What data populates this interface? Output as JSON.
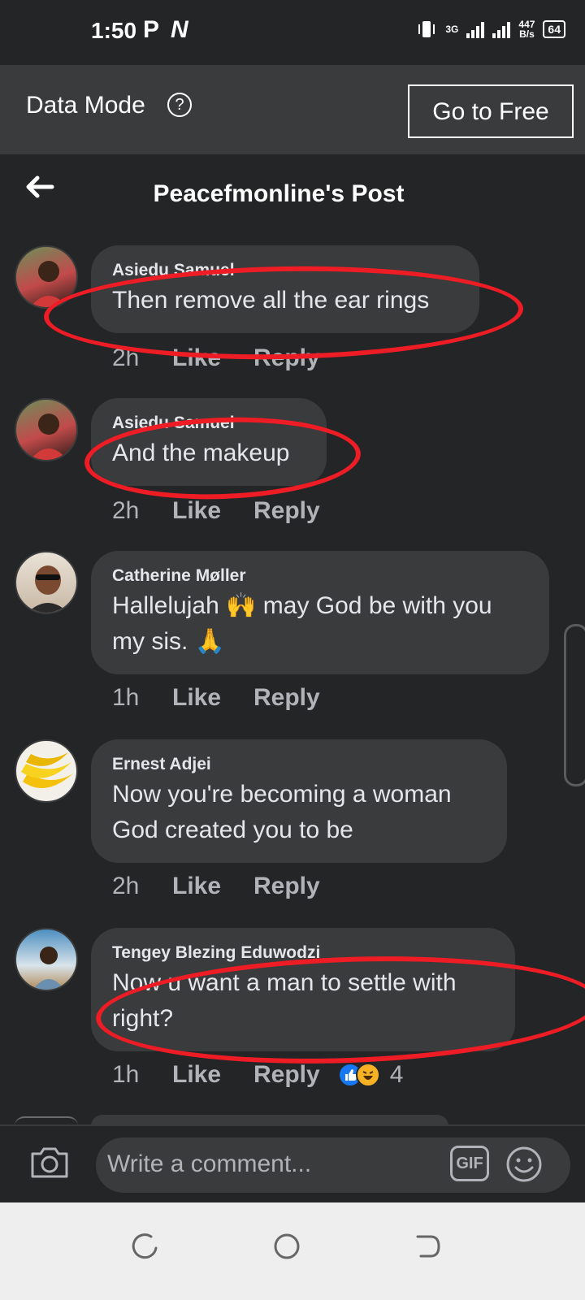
{
  "status": {
    "time": "1:50",
    "app_icons": [
      "P",
      "N"
    ],
    "network_label": "3G",
    "speed_value": "447",
    "speed_unit": "B/s",
    "battery": "64"
  },
  "data_mode": {
    "label": "Data Mode",
    "help_icon": "question-circle-icon",
    "button": "Go to Free"
  },
  "header": {
    "title": "Peacefmonline's Post",
    "back_icon": "arrow-left-icon"
  },
  "comments": [
    {
      "author": "Asiedu Samuel",
      "lines": [
        "Then remove all the ear rings"
      ],
      "time": "2h",
      "like": "Like",
      "reply": "Reply",
      "highlighted": true
    },
    {
      "author": "Asiedu Samuel",
      "lines": [
        "And the makeup"
      ],
      "time": "2h",
      "like": "Like",
      "reply": "Reply",
      "highlighted": true
    },
    {
      "author": "Catherine Møller",
      "lines": [
        "Hallelujah 🙌 may God be with you",
        "my sis. 🙏"
      ],
      "time": "1h",
      "like": "Like",
      "reply": "Reply",
      "highlighted": false
    },
    {
      "author": "Ernest Adjei",
      "lines": [
        "Now you're becoming a woman",
        "God created you to be"
      ],
      "time": "2h",
      "like": "Like",
      "reply": "Reply",
      "highlighted": false
    },
    {
      "author": "Tengey Blezing Eduwodzi",
      "lines": [
        "Now u want a man to settle with",
        "right?"
      ],
      "time": "1h",
      "like": "Like",
      "reply": "Reply",
      "highlighted": true,
      "reactions": [
        "like-reaction",
        "haha-reaction"
      ],
      "reaction_count": "4"
    }
  ],
  "composer": {
    "placeholder": "Write a comment...",
    "camera_icon": "camera-icon",
    "gif_label": "GIF",
    "emoji_icon": "smiley-icon"
  },
  "colors": {
    "background": "#242526",
    "bubble": "#3a3b3c",
    "highlight_ring": "#ee1c25",
    "like_blue": "#1877f2"
  }
}
